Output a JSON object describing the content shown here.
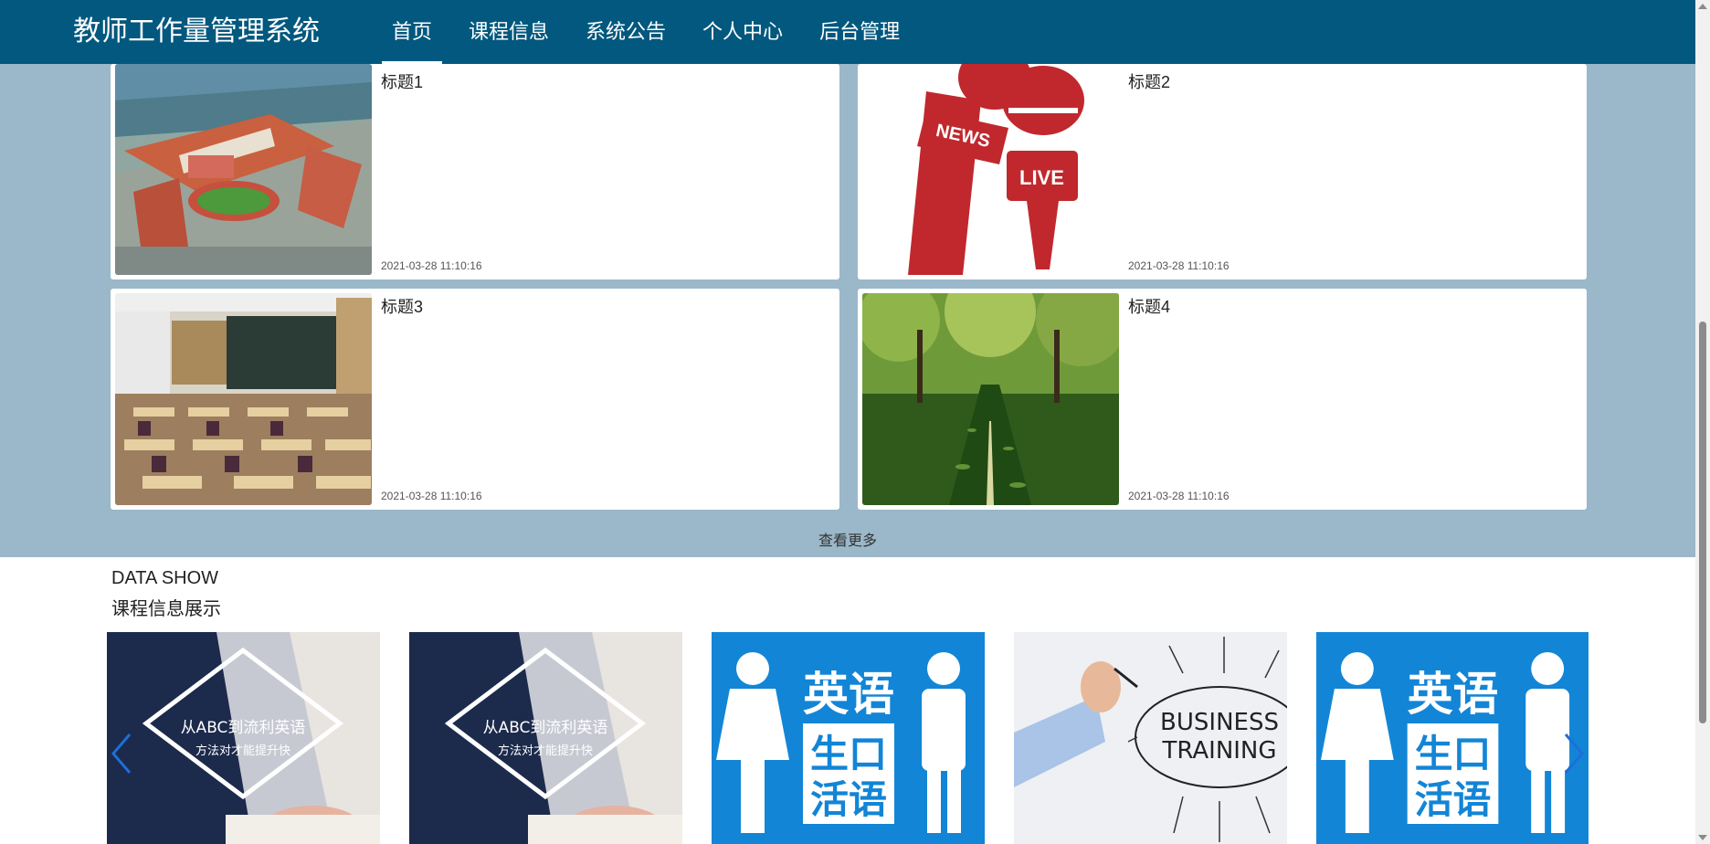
{
  "header": {
    "logo": "教师工作量管理系统",
    "nav": [
      "首页",
      "课程信息",
      "系统公告",
      "个人中心",
      "后台管理"
    ]
  },
  "news": [
    {
      "title": "标题1",
      "date": "2021-03-28 11:10:16",
      "image": "campus-aerial"
    },
    {
      "title": "标题2",
      "date": "2021-03-28 11:10:16",
      "image": "news-live-microphones"
    },
    {
      "title": "标题3",
      "date": "2021-03-28 11:10:16",
      "image": "classroom"
    },
    {
      "title": "标题4",
      "date": "2021-03-28 11:10:16",
      "image": "tree-lined-road"
    }
  ],
  "more_label": "查看更多",
  "data_show": {
    "title_en": "DATA SHOW",
    "title_cn": "课程信息展示",
    "items": [
      {
        "image": "abc-english",
        "text1": "从ABC到流利英语",
        "text2": "方法对才能提升快"
      },
      {
        "image": "abc-english",
        "text1": "从ABC到流利英语",
        "text2": "方法对才能提升快"
      },
      {
        "image": "spoken-english",
        "line1": "英语",
        "line2": "生口",
        "line3": "活语"
      },
      {
        "image": "business-training",
        "line1": "BUSINESS",
        "line2": "TRAINING"
      },
      {
        "image": "spoken-english",
        "line1": "英语",
        "line2": "生口",
        "line3": "活语"
      }
    ]
  },
  "colors": {
    "nav_bg": "#02587e",
    "section_bg": "#9ab8c9",
    "arrow": "#1e6fd9",
    "blue_poster": "#1285d6"
  }
}
